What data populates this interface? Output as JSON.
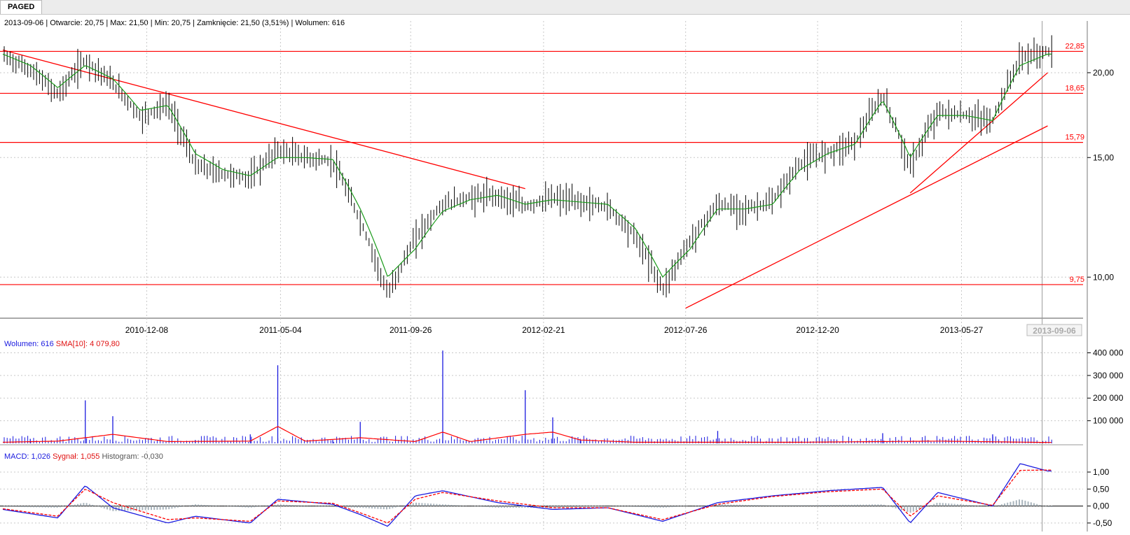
{
  "tab_label": "PAGED",
  "info_line": "2013-09-06 | Otwarcie: 20,75 | Max: 21,50 | Min: 20,75 | Zamknięcie: 21,50 (3,51%) | Wolumen: 616",
  "volume_label": {
    "volume_text": "Wolumen: 616",
    "sma_text": "SMA[10]: 4 079,80"
  },
  "macd_label": {
    "macd_text": "MACD: 1,026",
    "signal_text": "Sygnał: 1,055",
    "histogram_text": "Histogram: -0,030"
  },
  "colors": {
    "candle": "#000000",
    "sma_price": "#1a9a1a",
    "levels": "#ff0000",
    "volume_bars": "#1a1adf",
    "volume_sma": "#ff0000",
    "macd": "#1a1adf",
    "signal": "#ff0000",
    "histogram": "#a8b4bc",
    "grid": "#c8c8c8"
  },
  "chart_data": [
    {
      "type": "line",
      "title": "",
      "x_ticks": [
        "2010-12-08",
        "2011-05-04",
        "2011-09-26",
        "2012-02-21",
        "2012-07-26",
        "2012-12-20",
        "2013-05-27"
      ],
      "current_date_label": "2013-09-06",
      "y_ticks": [
        "10,00",
        "15,00",
        "20,00"
      ],
      "y_scale": "log",
      "ylim": [
        8.7,
        23.0
      ],
      "price_axis_side": "right",
      "horizontal_levels": [
        {
          "label": "22,85",
          "value": 21.5
        },
        {
          "label": "18,65",
          "value": 18.65
        },
        {
          "label": "15,79",
          "value": 15.79
        },
        {
          "label": "9,75",
          "value": 9.75
        }
      ],
      "trendlines": [
        {
          "from": [
            "2010-07",
            21.6
          ],
          "to": [
            "2012-02",
            13.5
          ]
        },
        {
          "from": [
            "2012-07-26",
            9.0
          ],
          "to": [
            "2013-09",
            16.7
          ]
        },
        {
          "from": [
            "2013-04",
            13.3
          ],
          "to": [
            "2013-09",
            20.0
          ]
        }
      ],
      "series": [
        {
          "name": "",
          "kind": "ohlc",
          "x": [
            "2010-07",
            "2010-08",
            "2010-09",
            "2010-10",
            "2010-11",
            "2010-12",
            "2011-01",
            "2011-02",
            "2011-03",
            "2011-04",
            "2011-05",
            "2011-06",
            "2011-07",
            "2011-08",
            "2011-09",
            "2011-10",
            "2011-11",
            "2011-12",
            "2012-01",
            "2012-02",
            "2012-03",
            "2012-04",
            "2012-05",
            "2012-06",
            "2012-07",
            "2012-08",
            "2012-09",
            "2012-10",
            "2012-11",
            "2012-12",
            "2013-01",
            "2013-02",
            "2013-03",
            "2013-04",
            "2013-05",
            "2013-06",
            "2013-07",
            "2013-08",
            "2013-09"
          ],
          "close": [
            21.2,
            20.2,
            18.6,
            20.9,
            19.3,
            17.2,
            18.0,
            14.6,
            14.2,
            14.0,
            15.4,
            15.0,
            14.8,
            12.1,
            9.4,
            11.4,
            12.8,
            13.1,
            13.2,
            12.7,
            13.1,
            12.9,
            12.7,
            11.5,
            9.6,
            11.3,
            12.8,
            12.6,
            12.9,
            14.7,
            15.3,
            15.8,
            18.5,
            14.5,
            17.5,
            17.3,
            17.0,
            21.0,
            21.5
          ]
        },
        {
          "name": "",
          "kind": "sma",
          "x": [
            "2010-07",
            "2010-08",
            "2010-09",
            "2010-10",
            "2010-11",
            "2010-12",
            "2011-01",
            "2011-02",
            "2011-03",
            "2011-04",
            "2011-05",
            "2011-06",
            "2011-07",
            "2011-08",
            "2011-09",
            "2011-10",
            "2011-11",
            "2011-12",
            "2012-01",
            "2012-02",
            "2012-03",
            "2012-04",
            "2012-05",
            "2012-06",
            "2012-07",
            "2012-08",
            "2012-09",
            "2012-10",
            "2012-11",
            "2012-12",
            "2013-01",
            "2013-02",
            "2013-03",
            "2013-04",
            "2013-05",
            "2013-06",
            "2013-07",
            "2013-08",
            "2013-09"
          ],
          "values": [
            21.3,
            20.5,
            19.0,
            20.5,
            19.6,
            17.6,
            17.9,
            15.2,
            14.4,
            14.1,
            15.0,
            15.0,
            14.9,
            12.6,
            10.0,
            11.0,
            12.5,
            13.0,
            13.2,
            12.8,
            13.0,
            12.9,
            12.8,
            11.8,
            10.0,
            11.0,
            12.6,
            12.6,
            12.8,
            14.4,
            15.2,
            15.7,
            18.2,
            15.0,
            17.3,
            17.3,
            17.0,
            20.5,
            21.3
          ]
        }
      ]
    },
    {
      "type": "bar",
      "title": "",
      "y_ticks": [
        "100 000",
        "200 000",
        "300 000",
        "400 000"
      ],
      "ylim": [
        0,
        420000
      ],
      "series": [
        {
          "name": "Wolumen",
          "kind": "bar",
          "x": [
            "2010-08",
            "2010-10",
            "2010-11",
            "2011-02",
            "2011-04",
            "2011-05",
            "2011-07",
            "2011-08",
            "2011-11",
            "2012-02",
            "2012-03",
            "2012-04",
            "2012-09",
            "2013-03",
            "2013-07"
          ],
          "values": [
            20000,
            190000,
            120000,
            15000,
            40000,
            345000,
            15000,
            95000,
            410000,
            235000,
            115000,
            20000,
            55000,
            45000,
            40000
          ]
        },
        {
          "name": "SMA[10]",
          "kind": "line",
          "x": [
            "2010-07",
            "2010-09",
            "2010-11",
            "2011-01",
            "2011-04",
            "2011-05",
            "2011-06",
            "2011-08",
            "2011-10",
            "2011-11",
            "2011-12",
            "2012-02",
            "2012-03",
            "2012-04",
            "2012-06",
            "2012-12",
            "2013-05",
            "2013-09"
          ],
          "values": [
            5000,
            10000,
            40000,
            8000,
            10000,
            75000,
            10000,
            25000,
            8000,
            50000,
            8000,
            40000,
            50000,
            15000,
            5000,
            5000,
            10000,
            4080
          ]
        }
      ]
    },
    {
      "type": "line",
      "title": "",
      "y_ticks": [
        "-0,50",
        "0,00",
        "0,50",
        "1,00"
      ],
      "ylim": [
        -0.75,
        1.35
      ],
      "series": [
        {
          "name": "MACD",
          "kind": "line",
          "x": [
            "2010-07",
            "2010-09",
            "2010-10",
            "2010-11",
            "2011-01",
            "2011-02",
            "2011-04",
            "2011-05",
            "2011-07",
            "2011-08",
            "2011-09",
            "2011-10",
            "2011-11",
            "2012-01",
            "2012-03",
            "2012-05",
            "2012-07",
            "2012-09",
            "2012-11",
            "2013-01",
            "2013-03",
            "2013-04",
            "2013-05",
            "2013-07",
            "2013-08",
            "2013-09"
          ],
          "values": [
            -0.1,
            -0.35,
            0.6,
            -0.05,
            -0.5,
            -0.3,
            -0.5,
            0.2,
            0.05,
            -0.25,
            -0.6,
            0.3,
            0.45,
            0.1,
            -0.1,
            -0.05,
            -0.45,
            0.1,
            0.3,
            0.45,
            0.55,
            -0.5,
            0.4,
            0.0,
            1.25,
            1.03
          ]
        },
        {
          "name": "Sygnał",
          "kind": "line",
          "x": [
            "2010-07",
            "2010-09",
            "2010-10",
            "2010-11",
            "2011-01",
            "2011-02",
            "2011-04",
            "2011-05",
            "2011-07",
            "2011-08",
            "2011-09",
            "2011-10",
            "2011-11",
            "2012-01",
            "2012-03",
            "2012-05",
            "2012-07",
            "2012-09",
            "2012-11",
            "2013-01",
            "2013-03",
            "2013-04",
            "2013-05",
            "2013-07",
            "2013-08",
            "2013-09"
          ],
          "values": [
            -0.08,
            -0.3,
            0.5,
            0.1,
            -0.4,
            -0.35,
            -0.45,
            0.15,
            0.08,
            -0.2,
            -0.5,
            0.2,
            0.4,
            0.15,
            -0.05,
            -0.05,
            -0.4,
            0.05,
            0.28,
            0.42,
            0.5,
            -0.3,
            0.3,
            0.02,
            1.05,
            1.06
          ]
        },
        {
          "name": "Histogram",
          "kind": "bar",
          "x": [
            "2010-07",
            "2010-09",
            "2010-10",
            "2010-11",
            "2011-01",
            "2011-02",
            "2011-04",
            "2011-05",
            "2011-07",
            "2011-08",
            "2011-09",
            "2011-10",
            "2011-11",
            "2012-01",
            "2012-03",
            "2012-05",
            "2012-07",
            "2012-09",
            "2012-11",
            "2013-01",
            "2013-03",
            "2013-04",
            "2013-05",
            "2013-07",
            "2013-08",
            "2013-09"
          ],
          "values": [
            -0.02,
            -0.05,
            0.1,
            -0.15,
            -0.1,
            0.05,
            -0.05,
            0.05,
            -0.03,
            -0.05,
            -0.1,
            0.1,
            0.05,
            -0.05,
            -0.05,
            0.0,
            -0.05,
            0.05,
            0.02,
            0.03,
            0.05,
            -0.2,
            0.1,
            -0.02,
            0.2,
            -0.03
          ]
        }
      ]
    }
  ]
}
